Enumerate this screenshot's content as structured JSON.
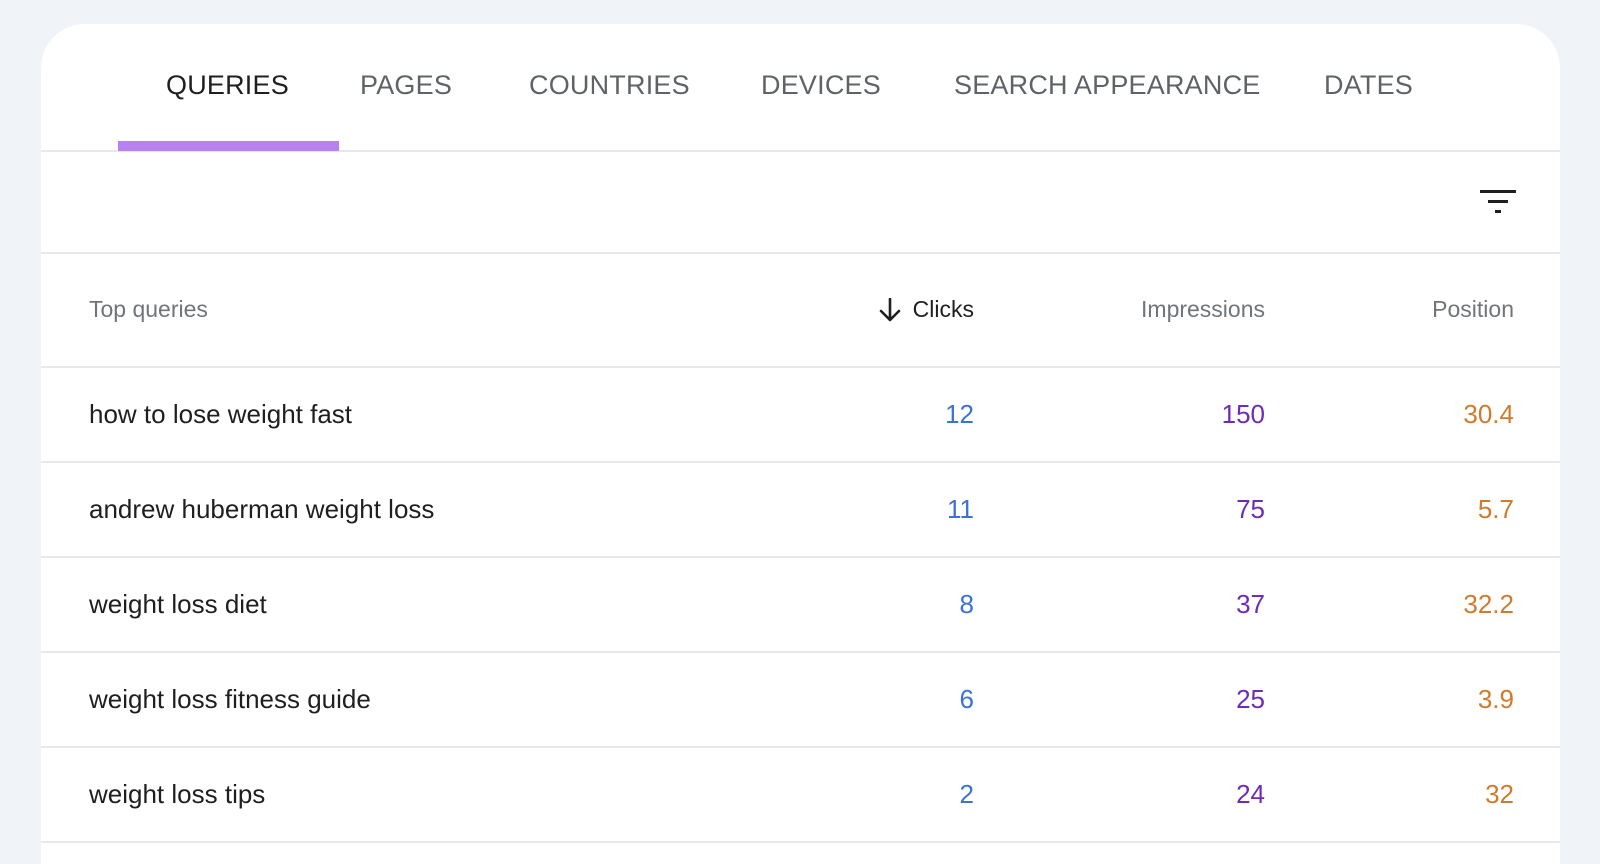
{
  "tabs": [
    {
      "label": "QUERIES",
      "active": true
    },
    {
      "label": "PAGES"
    },
    {
      "label": "COUNTRIES"
    },
    {
      "label": "DEVICES"
    },
    {
      "label": "SEARCH APPEARANCE"
    },
    {
      "label": "DATES"
    }
  ],
  "toolbar": {
    "filter_icon": "filter-icon"
  },
  "table": {
    "headers": {
      "query": "Top queries",
      "clicks": "Clicks",
      "impressions": "Impressions",
      "position": "Position",
      "sort_icon": "arrow-down-icon"
    },
    "rows": [
      {
        "query": "how to lose weight fast",
        "clicks": "12",
        "impressions": "150",
        "position": "30.4"
      },
      {
        "query": "andrew huberman weight loss",
        "clicks": "11",
        "impressions": "75",
        "position": "5.7"
      },
      {
        "query": "weight loss diet",
        "clicks": "8",
        "impressions": "37",
        "position": "32.2"
      },
      {
        "query": "weight loss fitness guide",
        "clicks": "6",
        "impressions": "25",
        "position": "3.9"
      },
      {
        "query": "weight loss tips",
        "clicks": "2",
        "impressions": "24",
        "position": "32"
      }
    ]
  },
  "colors": {
    "clicks": "#3a72d8",
    "impressions": "#6f2bb8",
    "position": "#d27a2a",
    "tab_indicator": "#b780f3",
    "background": "#f0f4f9"
  }
}
